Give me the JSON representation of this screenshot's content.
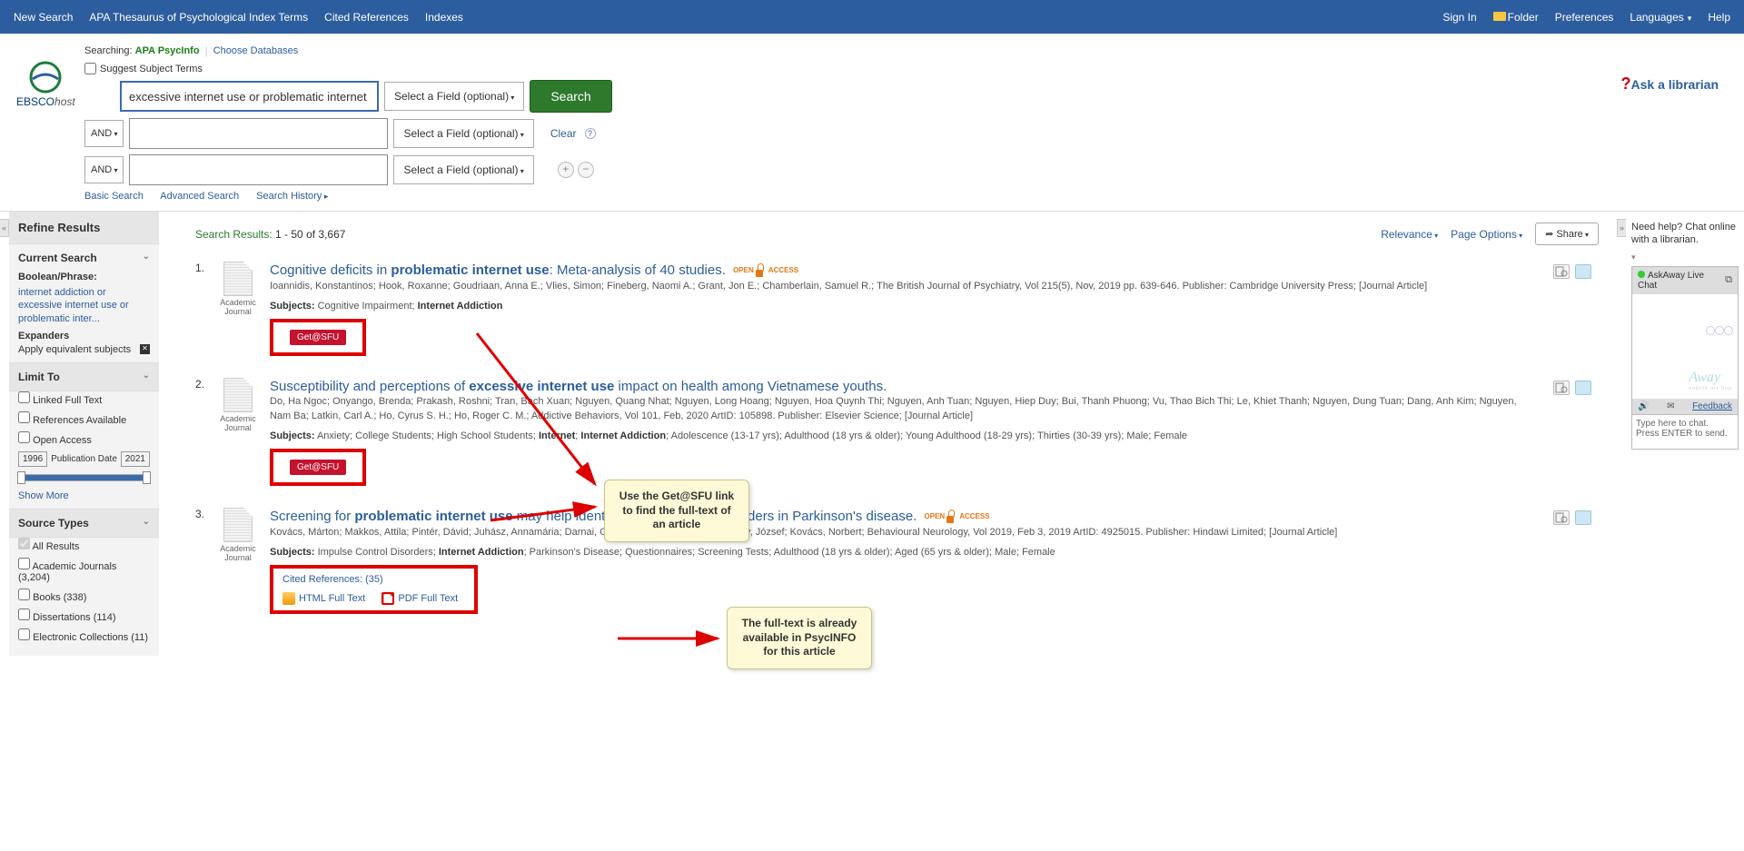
{
  "topnav": {
    "left": [
      "New Search",
      "APA Thesaurus of Psychological Index Terms",
      "Cited References",
      "Indexes"
    ],
    "right": [
      "Sign In",
      "Folder",
      "Preferences",
      "Languages",
      "Help"
    ]
  },
  "logo": {
    "brand": "EBSCO",
    "suffix": "host"
  },
  "ask_librarian": "Ask a librarian",
  "search": {
    "searching_label": "Searching:",
    "database": "APA PsycInfo",
    "choose_db": "Choose Databases",
    "suggest_label": "Suggest Subject Terms",
    "row1_value": "excessive internet use or problematic internet use",
    "row2_value": "",
    "row3_value": "",
    "bool": "AND",
    "field_label": "Select a Field (optional)",
    "search_btn": "Search",
    "clear": "Clear",
    "basic": "Basic Search",
    "advanced": "Advanced Search",
    "history": "Search History"
  },
  "refine": {
    "title": "Refine Results",
    "current_search": "Current Search",
    "bool_label": "Boolean/Phrase:",
    "phrase": "internet addiction or excessive internet use or problematic inter...",
    "expanders": "Expanders",
    "apply_eq": "Apply equivalent subjects",
    "limit_to": "Limit To",
    "limit1": "Linked Full Text",
    "limit2": "References Available",
    "limit3": "Open Access",
    "pub_from": "1996",
    "pub_to": "2021",
    "pub_label": "Publication Date",
    "show_more": "Show More",
    "source_types": "Source Types",
    "st_all": "All Results",
    "st_journals": "Academic Journals (3,204)",
    "st_books": "Books (338)",
    "st_diss": "Dissertations (114)",
    "st_elec": "Electronic Collections (11)"
  },
  "results_head": {
    "label": "Search Results:",
    "range": "1 - 50 of 3,667",
    "relevance": "Relevance",
    "page_options": "Page Options",
    "share": "Share"
  },
  "results": [
    {
      "num": "1.",
      "title_pre": "Cognitive deficits in ",
      "title_bold": "problematic internet use",
      "title_post": ": Meta-analysis of 40 studies.",
      "open_access": true,
      "thumb": "Academic Journal",
      "authors": "Ioannidis, Konstantinos; Hook, Roxanne; Goudriaan, Anna E.; Vlies, Simon; Fineberg, Naomi A.; Grant, Jon E.; Chamberlain, Samuel R.; The British Journal of Psychiatry, Vol 215(5), Nov, 2019 pp. 639-646. Publisher: Cambridge University Press; [Journal Article]",
      "subjects_pre": "Cognitive Impairment; ",
      "subjects_bold": "Internet Addiction",
      "subjects_post": "",
      "getsfu": "Get@SFU"
    },
    {
      "num": "2.",
      "title_pre": "Susceptibility and perceptions of ",
      "title_bold": "excessive internet use",
      "title_post": " impact on health among Vietnamese youths.",
      "open_access": false,
      "thumb": "Academic Journal",
      "authors": "Do, Ha Ngoc; Onyango, Brenda; Prakash, Roshni; Tran, Bach Xuan; Nguyen, Quang Nhat; Nguyen, Long Hoang; Nguyen, Hoa Quynh Thi; Nguyen, Anh Tuan; Nguyen, Hiep Duy; Bui, Thanh Phuong; Vu, Thao Bich Thi; Le, Khiet Thanh; Nguyen, Dung Tuan; Dang, Anh Kim; Nguyen, Nam Ba; Latkin, Carl A.; Ho, Cyrus S. H.; Ho, Roger C. M.; Addictive Behaviors, Vol 101, Feb, 2020 ArtID: 105898. Publisher: Elsevier Science; [Journal Article]",
      "subjects_pre": "Anxiety; College Students; High School Students; ",
      "subjects_bold": "Internet",
      "subjects_mid": "; ",
      "subjects_bold2": "Internet Addiction",
      "subjects_post": "; Adolescence (13-17 yrs); Adulthood (18 yrs & older); Young Adulthood (18-29 yrs); Thirties (30-39 yrs); Male; Female",
      "getsfu": "Get@SFU"
    },
    {
      "num": "3.",
      "title_pre": "Screening for ",
      "title_bold": "problematic internet use",
      "title_post": " may help identify impulse control disorders in Parkinson's disease.",
      "open_access": true,
      "thumb": "Academic Journal",
      "authors": "Kovács, Márton; Makkos, Attila; Pintér, Dávid; Juhász, Annamária; Darnai, Gergely; Karádi, Kázmér; Janszky, József; Kovács, Norbert; Behavioural Neurology, Vol 2019, Feb 3, 2019 ArtID: 4925015. Publisher: Hindawi Limited; [Journal Article]",
      "subjects_pre": "Impulse Control Disorders; ",
      "subjects_bold": "Internet Addiction",
      "subjects_post": "; Parkinson's Disease; Questionnaires; Screening Tests; Adulthood (18 yrs & older); Aged (65 yrs & older); Male; Female",
      "cited": "Cited References: ",
      "cited_count": "(35)",
      "html_ft": "HTML Full Text",
      "pdf_ft": "PDF Full Text"
    }
  ],
  "callout1": "Use the Get@SFU link to find the full-text of an article",
  "callout2": "The full-text is already available in PsycINFO for this article",
  "chat": {
    "need_help": "Need help? Chat online with a librarian.",
    "title": "AskAway Live Chat",
    "away": "Away",
    "away_sub": "endrík nit hup",
    "feedback": "Feedback",
    "placeholder": "Type here to chat. Press ENTER to send."
  }
}
